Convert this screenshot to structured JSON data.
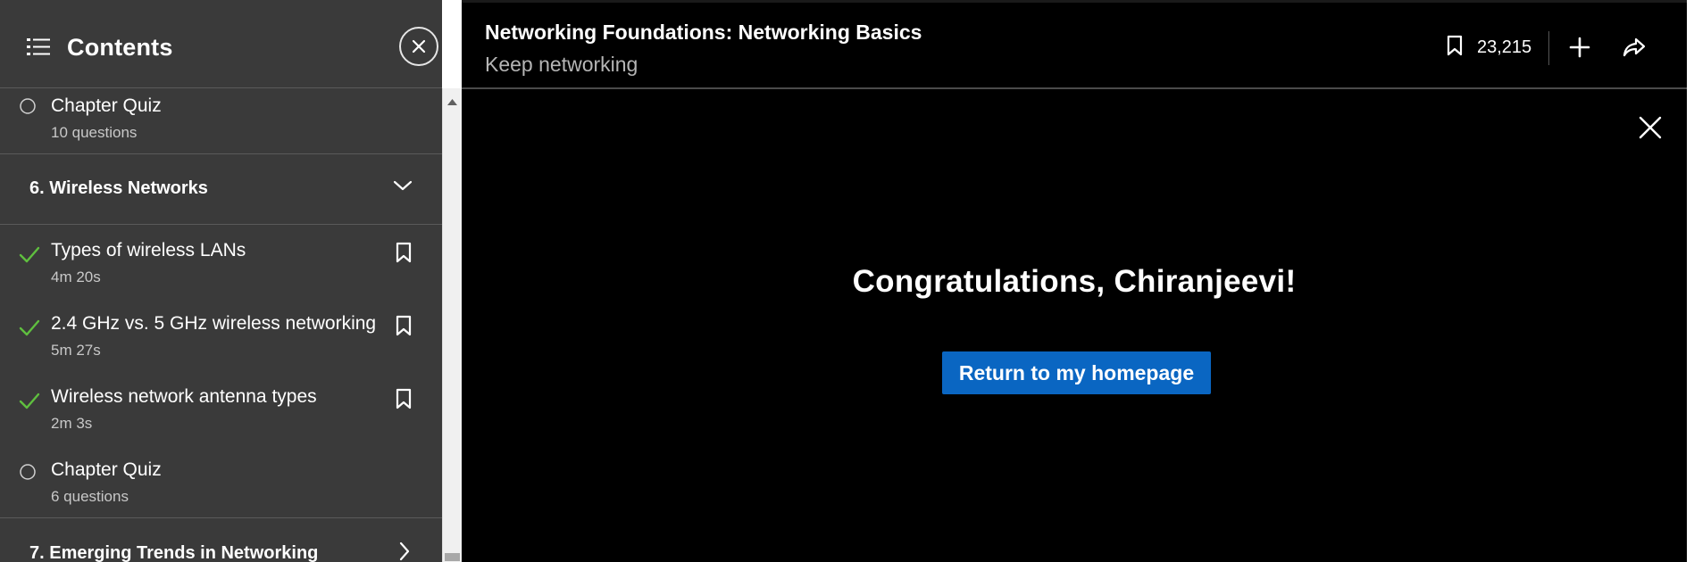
{
  "sidebar": {
    "title": "Contents",
    "items_top": [
      {
        "title": "Chapter Quiz",
        "sub": "10 questions",
        "status": "not-started",
        "bookmark": false
      }
    ],
    "chapter6": {
      "title": "6. Wireless Networks",
      "expanded": true
    },
    "items": [
      {
        "title": "Types of wireless LANs",
        "sub": "4m 20s",
        "status": "completed",
        "bookmark": true
      },
      {
        "title": "2.4 GHz vs. 5 GHz wireless networking",
        "sub": "5m 27s",
        "status": "completed",
        "bookmark": true
      },
      {
        "title": "Wireless network antenna types",
        "sub": "2m 3s",
        "status": "completed",
        "bookmark": true
      },
      {
        "title": "Chapter Quiz",
        "sub": "6 questions",
        "status": "not-started",
        "bookmark": false
      }
    ],
    "chapter7": {
      "title": "7. Emerging Trends in Networking",
      "expanded": false
    }
  },
  "header": {
    "course_title": "Networking Foundations: Networking Basics",
    "subtitle": "Keep networking",
    "saves_count": "23,215"
  },
  "main": {
    "congrats": "Congratulations, Chiranjeevi!",
    "cta_label": "Return to my homepage"
  },
  "colors": {
    "sidebar_bg": "#3a3a3a",
    "main_bg": "#000000",
    "accent_blue": "#0a66c2",
    "check_green": "#5fbf3f",
    "muted_text": "#c8c8c8"
  },
  "icons": {
    "list": "list-icon",
    "close": "close-icon",
    "check": "check-icon",
    "circle": "circle-icon",
    "bookmark": "bookmark-icon",
    "chevron_down": "chevron-down-icon",
    "chevron_right": "chevron-right-icon",
    "plus": "plus-icon",
    "share": "share-icon"
  }
}
